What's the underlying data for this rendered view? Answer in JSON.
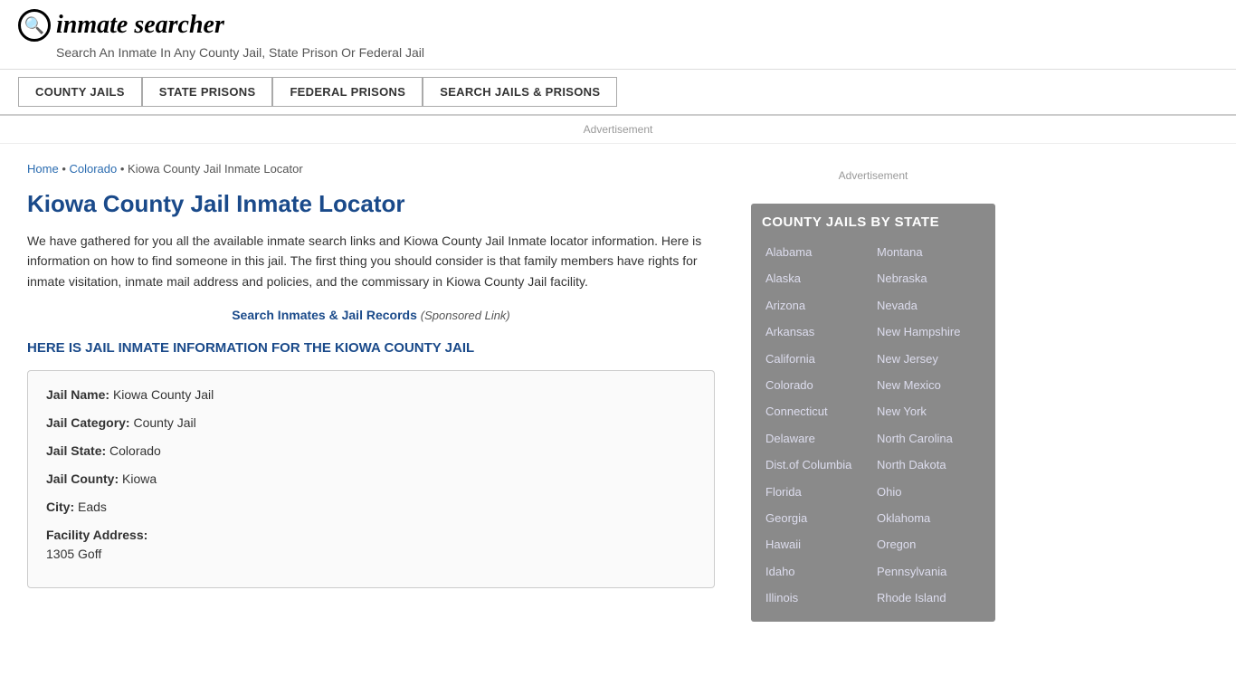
{
  "header": {
    "logo_icon": "🔍",
    "logo_text": "inmate searcher",
    "tagline": "Search An Inmate In Any County Jail, State Prison Or Federal Jail"
  },
  "nav": {
    "buttons": [
      {
        "label": "COUNTY JAILS",
        "active": true
      },
      {
        "label": "STATE PRISONS",
        "active": false
      },
      {
        "label": "FEDERAL PRISONS",
        "active": false
      },
      {
        "label": "SEARCH JAILS & PRISONS",
        "active": false
      }
    ]
  },
  "ad": {
    "label": "Advertisement"
  },
  "breadcrumb": {
    "home": "Home",
    "state": "Colorado",
    "current": "Kiowa County Jail Inmate Locator"
  },
  "page": {
    "title": "Kiowa County Jail Inmate Locator",
    "description": "We have gathered for you all the available inmate search links and Kiowa County Jail Inmate locator information. Here is information on how to find someone in this jail. The first thing you should consider is that family members have rights for inmate visitation, inmate mail address and policies, and the commissary in Kiowa County Jail facility.",
    "sponsored_link_text": "Search Inmates & Jail Records",
    "sponsored_label": "(Sponsored Link)",
    "section_heading": "HERE IS JAIL INMATE INFORMATION FOR THE KIOWA COUNTY JAIL",
    "info": {
      "jail_name_label": "Jail Name:",
      "jail_name_value": "Kiowa County Jail",
      "jail_category_label": "Jail Category:",
      "jail_category_value": "County Jail",
      "jail_state_label": "Jail State:",
      "jail_state_value": "Colorado",
      "jail_county_label": "Jail County:",
      "jail_county_value": "Kiowa",
      "city_label": "City:",
      "city_value": "Eads",
      "facility_address_label": "Facility Address:",
      "facility_address_value": "1305 Goff"
    }
  },
  "sidebar": {
    "ad_label": "Advertisement",
    "state_box": {
      "title": "COUNTY JAILS BY STATE",
      "col1": [
        "Alabama",
        "Alaska",
        "Arizona",
        "Arkansas",
        "California",
        "Colorado",
        "Connecticut",
        "Delaware",
        "Dist.of Columbia",
        "Florida",
        "Georgia",
        "Hawaii",
        "Idaho",
        "Illinois"
      ],
      "col2": [
        "Montana",
        "Nebraska",
        "Nevada",
        "New Hampshire",
        "New Jersey",
        "New Mexico",
        "New York",
        "North Carolina",
        "North Dakota",
        "Ohio",
        "Oklahoma",
        "Oregon",
        "Pennsylvania",
        "Rhode Island"
      ]
    }
  }
}
